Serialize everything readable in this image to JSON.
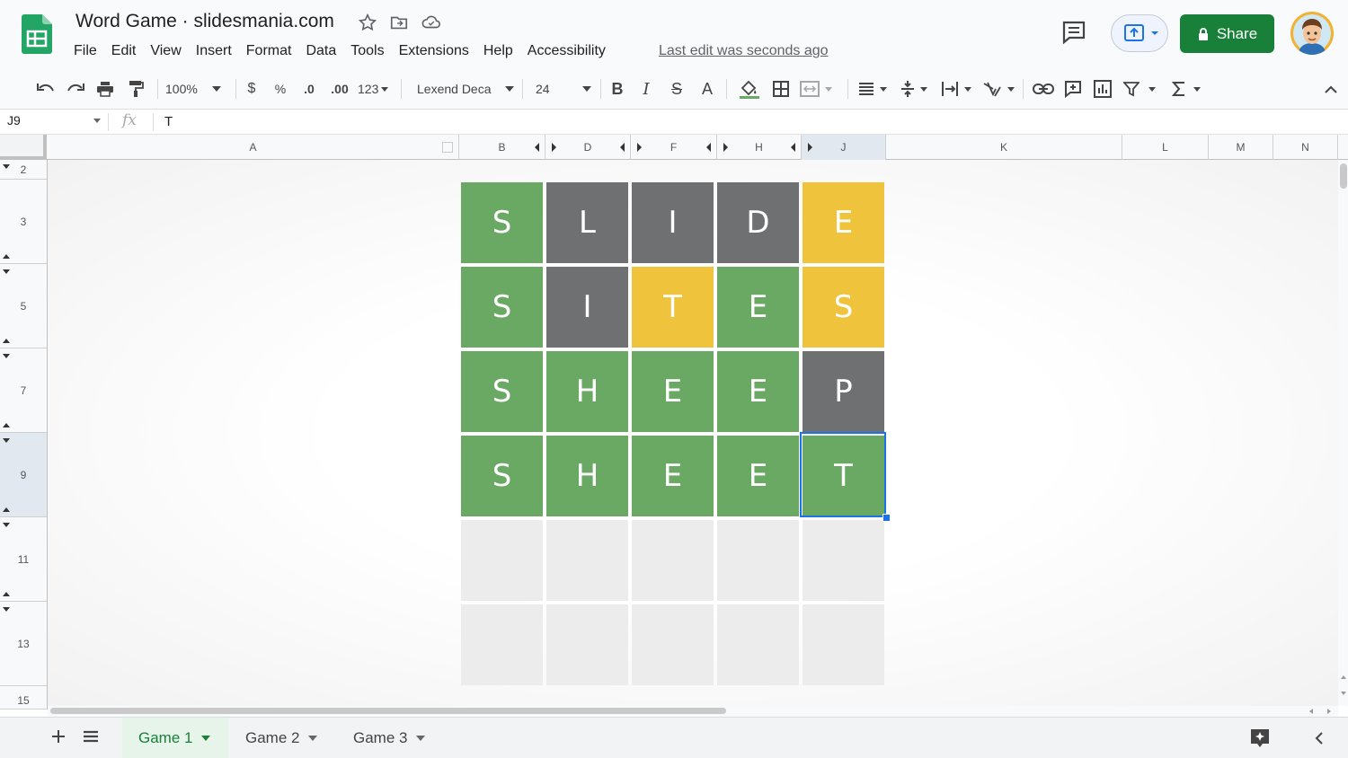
{
  "app": {
    "title": "Word Game · slidesmania.com",
    "menu": [
      "File",
      "Edit",
      "View",
      "Insert",
      "Format",
      "Data",
      "Tools",
      "Extensions",
      "Help",
      "Accessibility"
    ],
    "last_edit": "Last edit was seconds ago",
    "share_label": "Share"
  },
  "toolbar": {
    "zoom": "100%",
    "currency": "$",
    "percent": "%",
    "dec_decrease": ".0",
    "dec_increase": ".00",
    "format_more": "123",
    "font": "Lexend Deca",
    "font_size": "24",
    "bold": "B",
    "italic": "I",
    "strike": "S",
    "text_color": "A"
  },
  "formula_bar": {
    "cell_ref": "J9",
    "fx": "fx",
    "value": "T"
  },
  "columns": [
    "A",
    "B",
    "D",
    "F",
    "H",
    "J",
    "K",
    "L",
    "M",
    "N"
  ],
  "rows": [
    "2",
    "3",
    "5",
    "7",
    "9",
    "11",
    "13",
    "15"
  ],
  "board": [
    [
      {
        "l": "S",
        "c": "green"
      },
      {
        "l": "L",
        "c": "gray"
      },
      {
        "l": "I",
        "c": "gray"
      },
      {
        "l": "D",
        "c": "gray"
      },
      {
        "l": "E",
        "c": "yellow"
      }
    ],
    [
      {
        "l": "S",
        "c": "green"
      },
      {
        "l": "I",
        "c": "gray"
      },
      {
        "l": "T",
        "c": "yellow"
      },
      {
        "l": "E",
        "c": "green"
      },
      {
        "l": "S",
        "c": "yellow"
      }
    ],
    [
      {
        "l": "S",
        "c": "green"
      },
      {
        "l": "H",
        "c": "green"
      },
      {
        "l": "E",
        "c": "green"
      },
      {
        "l": "E",
        "c": "green"
      },
      {
        "l": "P",
        "c": "gray"
      }
    ],
    [
      {
        "l": "S",
        "c": "green"
      },
      {
        "l": "H",
        "c": "green"
      },
      {
        "l": "E",
        "c": "green"
      },
      {
        "l": "E",
        "c": "green"
      },
      {
        "l": "T",
        "c": "green"
      }
    ],
    [
      {
        "l": "",
        "c": "empty"
      },
      {
        "l": "",
        "c": "empty"
      },
      {
        "l": "",
        "c": "empty"
      },
      {
        "l": "",
        "c": "empty"
      },
      {
        "l": "",
        "c": "empty"
      }
    ],
    [
      {
        "l": "",
        "c": "empty"
      },
      {
        "l": "",
        "c": "empty"
      },
      {
        "l": "",
        "c": "empty"
      },
      {
        "l": "",
        "c": "empty"
      },
      {
        "l": "",
        "c": "empty"
      }
    ]
  ],
  "sheets": [
    {
      "label": "Game 1",
      "active": true
    },
    {
      "label": "Game 2",
      "active": false
    },
    {
      "label": "Game 3",
      "active": false
    }
  ],
  "colors": {
    "green": "#6aa964",
    "gray": "#6f7071",
    "yellow": "#f0c33c",
    "accent": "#188038"
  }
}
